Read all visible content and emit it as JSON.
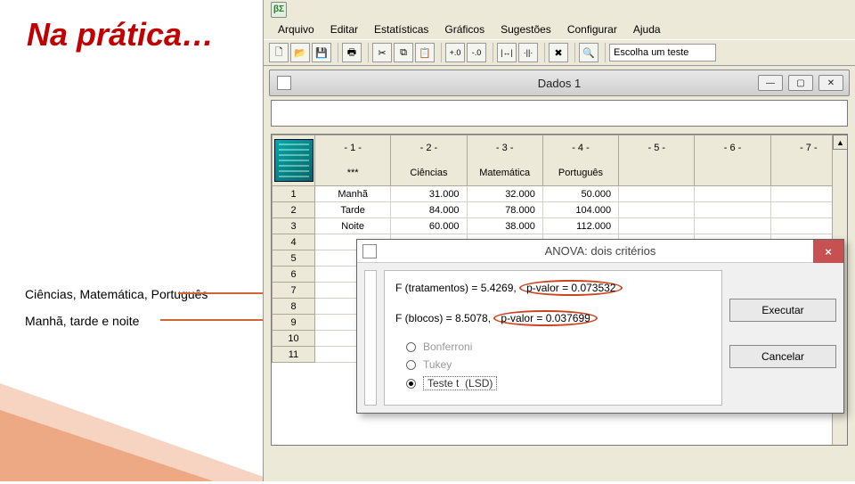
{
  "slide": {
    "title": "Na prática…",
    "label1": "Ciências, Matemática, Português",
    "label2": "Manhã, tarde e noite"
  },
  "app": {
    "icon": "βΣ",
    "menu": [
      "Arquivo",
      "Editar",
      "Estatísticas",
      "Gráficos",
      "Sugestões",
      "Configurar",
      "Ajuda"
    ],
    "toolbar": {
      "inc": "+.0",
      "dec": "-.0",
      "widen": "|↔|",
      "narrow": "·||·",
      "select_label": "Escolha um teste"
    },
    "doc_title": "Dados 1",
    "grid": {
      "col_nums": [
        "- 1 -",
        "- 2 -",
        "- 3 -",
        "- 4 -",
        "- 5 -",
        "- 6 -",
        "- 7 -"
      ],
      "col_names": [
        "***",
        "Ciências",
        "Matemática",
        "Português",
        "",
        "",
        ""
      ],
      "row_labels": [
        "Manhã",
        "Tarde",
        "Noite"
      ],
      "data": [
        [
          "31.000",
          "32.000",
          "50.000"
        ],
        [
          "84.000",
          "78.000",
          "104.000"
        ],
        [
          "60.000",
          "38.000",
          "112.000"
        ]
      ],
      "rownums": [
        "1",
        "2",
        "3",
        "4",
        "5",
        "6",
        "7",
        "8",
        "9",
        "10",
        "11"
      ]
    }
  },
  "dialog": {
    "title": "ANOVA: dois critérios",
    "line1_pre": "F (tratamentos) = 5.4269, ",
    "line1_hl": "p-valor = 0.073532",
    "line2_pre": "F (blocos) = 8.5078, ",
    "line2_hl": "p-valor = 0.037699",
    "radios": {
      "bonf": "Bonferroni",
      "tukey": "Tukey",
      "lsd_pre": "Teste t",
      "lsd_suf": "(LSD)"
    },
    "buttons": {
      "run": "Executar",
      "cancel": "Cancelar"
    }
  }
}
